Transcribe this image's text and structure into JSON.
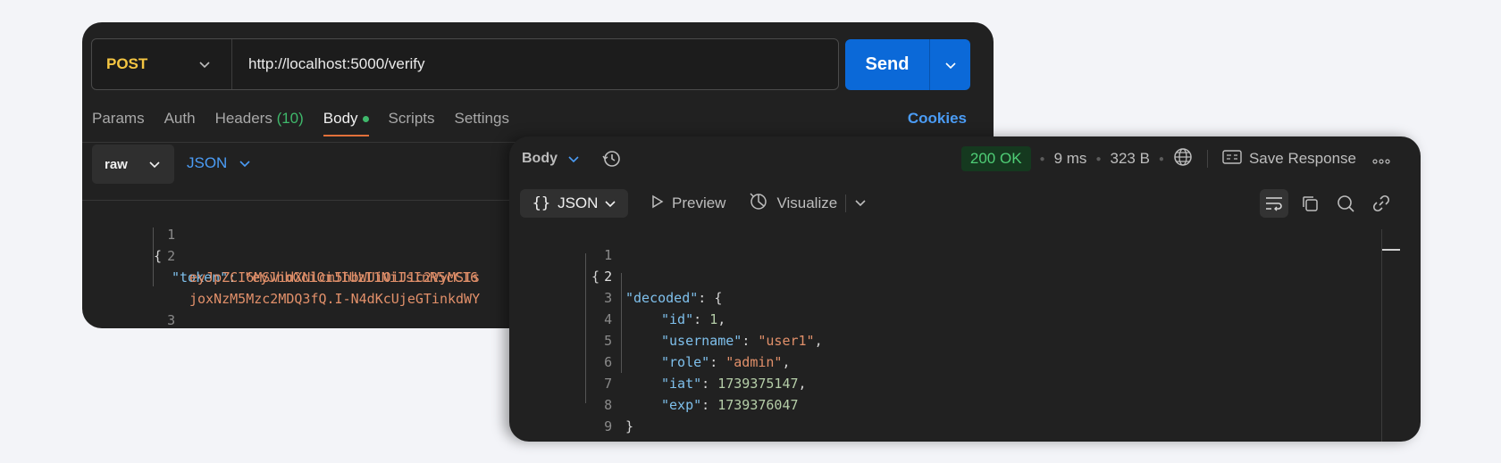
{
  "request": {
    "method": "POST",
    "url": "http://localhost:5000/verify",
    "send_label": "Send",
    "tabs": [
      {
        "label": "Params"
      },
      {
        "label": "Auth"
      },
      {
        "label": "Headers",
        "count": "(10)"
      },
      {
        "label": "Body",
        "active": true
      },
      {
        "label": "Scripts"
      },
      {
        "label": "Settings"
      }
    ],
    "cookies_label": "Cookies",
    "body_mode": "raw",
    "body_format": "JSON",
    "code": {
      "line1": "{",
      "line2_key": "\"token\"",
      "line2_colon": ": ",
      "line2_val": "\"eyJhbGciOiJIUzI1NiIsInR5cCI6",
      "line2b": "eyJpZCI6MSwidXNlcm5hbWUiOiJ1c2VyMSIs",
      "line2c": "joxNzM5Mzc2MDQ3fQ.I-N4dKcUjeGTinkdWY",
      "line3": "}",
      "numbers": [
        "1",
        "2",
        "3"
      ]
    }
  },
  "response": {
    "body_label": "Body",
    "status": "200 OK",
    "time": "9 ms",
    "size": "323 B",
    "save_label": "Save Response",
    "format_label": "JSON",
    "preview_label": "Preview",
    "visualize_label": "Visualize",
    "line_numbers": [
      "1",
      "2",
      "3",
      "4",
      "5",
      "6",
      "7",
      "8",
      "9"
    ],
    "code": {
      "l1": "{",
      "l2_key": "\"decoded\"",
      "l2_rest": ": {",
      "id_key": "\"id\"",
      "id_val": "1",
      "username_key": "\"username\"",
      "username_val": "\"user1\"",
      "role_key": "\"role\"",
      "role_val": "\"admin\"",
      "iat_key": "\"iat\"",
      "iat_val": "1739375147",
      "exp_key": "\"exp\"",
      "exp_val": "1739376047",
      "l8": "}",
      "l9": "}"
    }
  },
  "colors": {
    "accent_blue": "#0b69d8",
    "method_yellow": "#f4c542",
    "status_green": "#4fce76",
    "tab_underline": "#e2703a"
  },
  "icons": [
    "chevron-down-icon",
    "history-icon",
    "globe-icon",
    "save-response-icon",
    "more-icon",
    "preview-play-icon",
    "visualize-icon",
    "wrap-lines-icon",
    "copy-icon",
    "search-icon",
    "link-icon"
  ]
}
